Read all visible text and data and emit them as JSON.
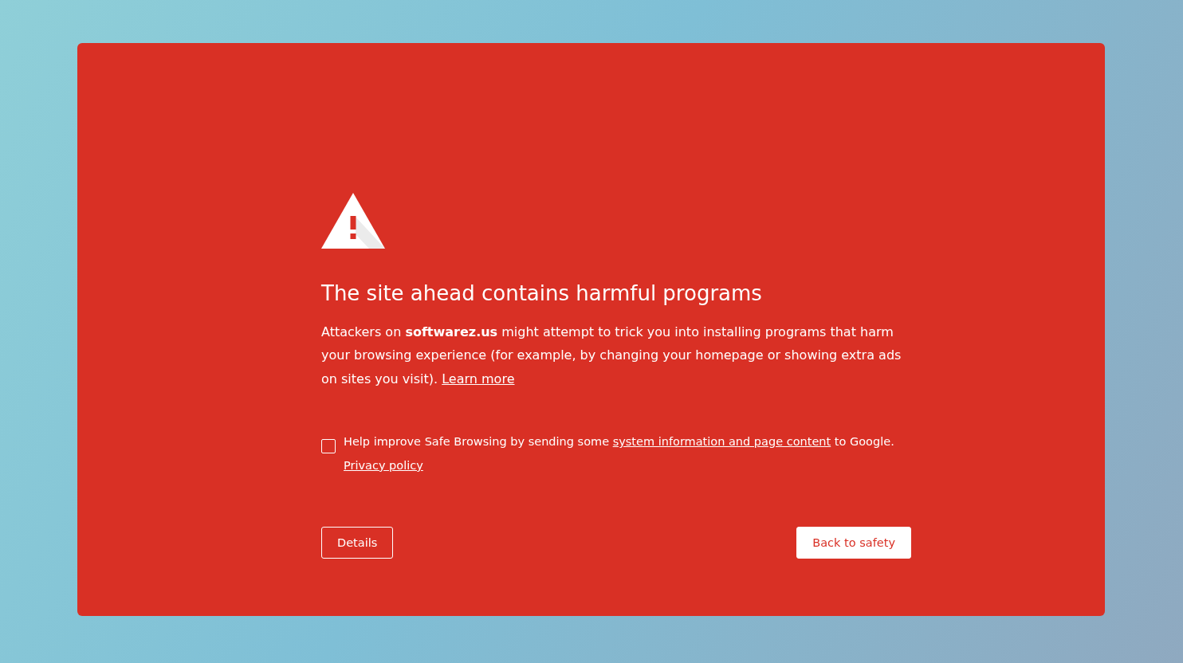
{
  "icon": {
    "kind": "warning"
  },
  "heading": "The site ahead contains harmful programs",
  "message": {
    "text": "Attackers on **softwarez.us** might attempt to trick you into installing programs that harm your browsing experience (for example, by changing your homepage or showing extra ads on sites you visit).",
    "link": "Learn more"
  },
  "report": {
    "checked": false,
    "before": "Help improve Safe Browsing by sending some",
    "link": "system information and page content",
    "after": "to Google.",
    "policy": "Privacy policy"
  },
  "buttons": [
    {
      "label": "Details",
      "kind": "secondary"
    },
    {
      "label": "Back to safety",
      "kind": "primary"
    }
  ]
}
